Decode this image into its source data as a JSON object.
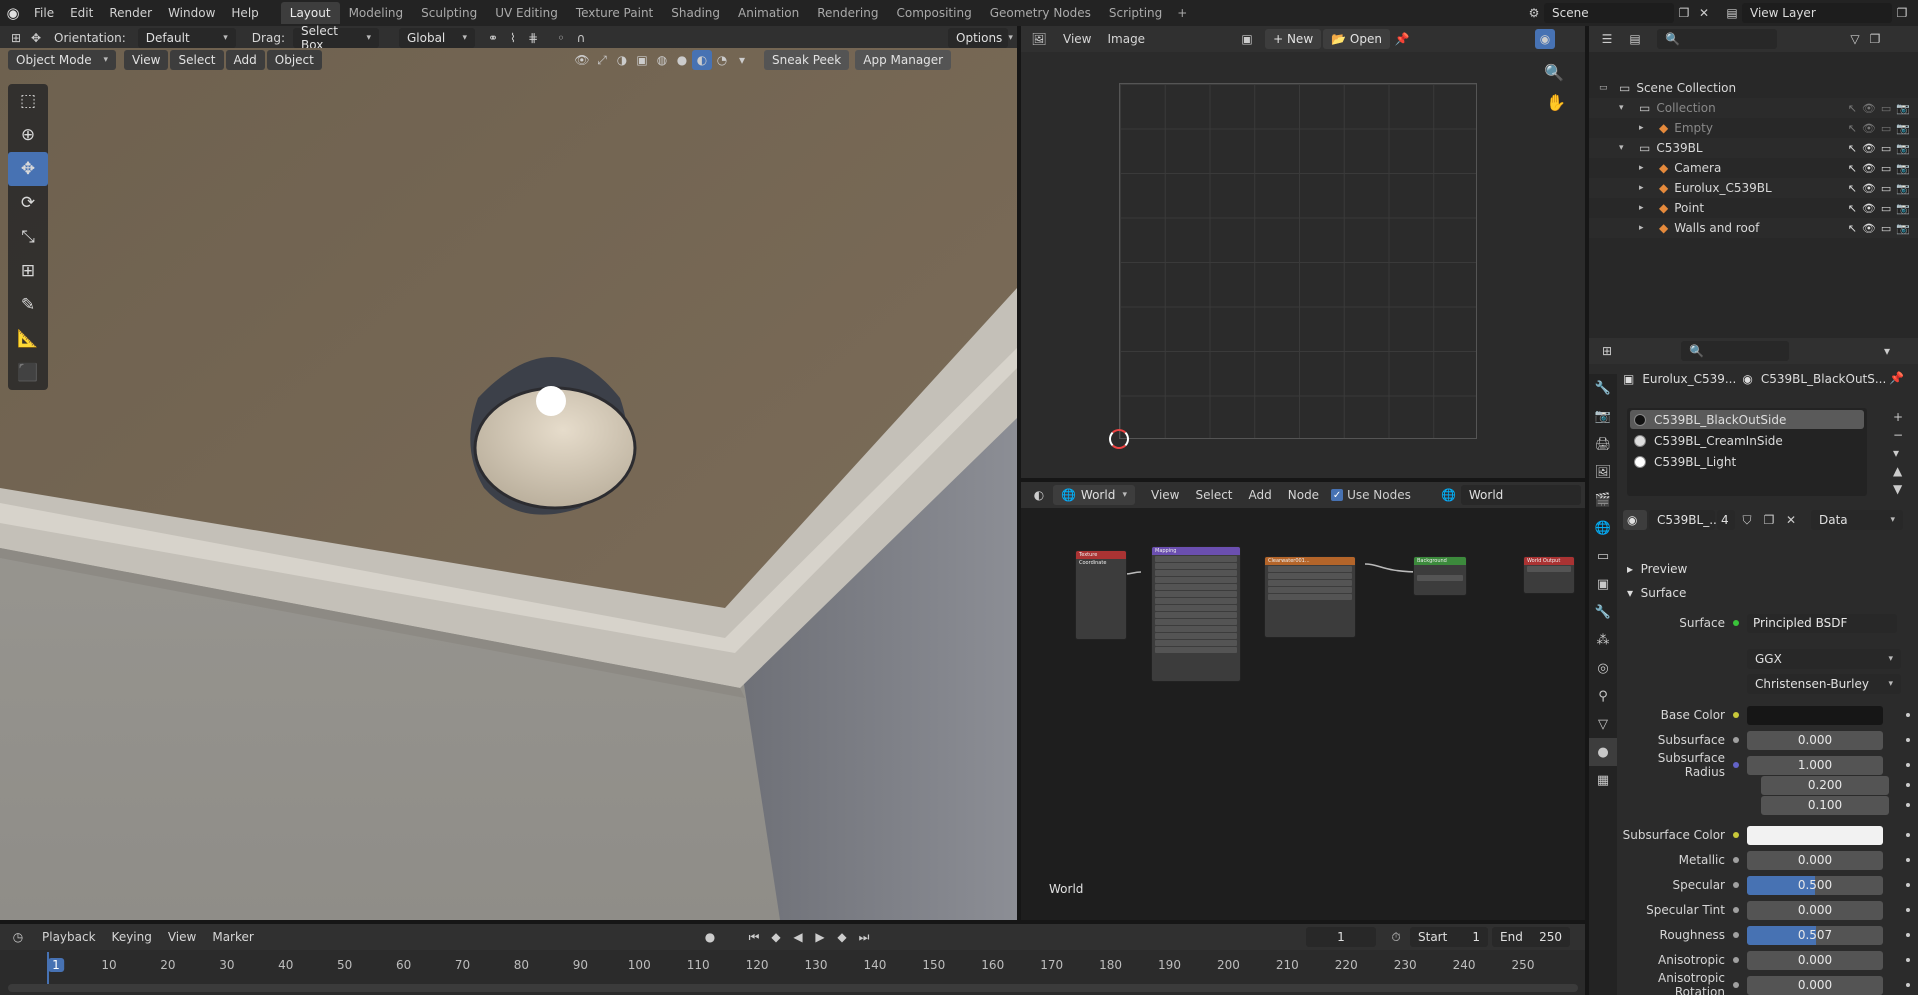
{
  "topbar": {
    "menus": [
      "File",
      "Edit",
      "Render",
      "Window",
      "Help"
    ],
    "workspaces": [
      "Layout",
      "Modeling",
      "Sculpting",
      "UV Editing",
      "Texture Paint",
      "Shading",
      "Animation",
      "Rendering",
      "Compositing",
      "Geometry Nodes",
      "Scripting"
    ],
    "active_workspace": "Layout",
    "scene": "Scene",
    "view_layer": "View Layer"
  },
  "viewport": {
    "orientation_label": "Orientation:",
    "orientation_value": "Default",
    "drag_label": "Drag:",
    "drag_value": "Select Box",
    "transform_space": "Global",
    "options": "Options",
    "mode": "Object Mode",
    "menus": [
      "View",
      "Select",
      "Add",
      "Object"
    ],
    "buttons": [
      "Sneak Peek",
      "App Manager"
    ]
  },
  "image_editor": {
    "menus": [
      "View",
      "Image"
    ],
    "new_label": "New",
    "open_label": "Open"
  },
  "node_editor": {
    "world_type": "World",
    "menus": [
      "View",
      "Select",
      "Add",
      "Node"
    ],
    "use_nodes_label": "Use Nodes",
    "use_nodes": true,
    "world_name": "World",
    "corner_label": "World",
    "nodes": [
      {
        "title": "Texture Coordinate",
        "color": "#a33"
      },
      {
        "title": "Mapping",
        "color": "#6b4fb0"
      },
      {
        "title": "Clearwater001...",
        "color": "#b4652a"
      },
      {
        "title": "Background",
        "color": "#3c8a3c"
      },
      {
        "title": "World Output",
        "color": "#a33"
      }
    ]
  },
  "outliner": {
    "items": [
      {
        "label": "Scene Collection",
        "level": 0
      },
      {
        "label": "Collection",
        "level": 1,
        "dim": true
      },
      {
        "label": "Empty",
        "level": 2,
        "dim": true
      },
      {
        "label": "C539BL",
        "level": 1
      },
      {
        "label": "Camera",
        "level": 2
      },
      {
        "label": "Eurolux_C539BL",
        "level": 2
      },
      {
        "label": "Point",
        "level": 2
      },
      {
        "label": "Walls and roof",
        "level": 2
      }
    ]
  },
  "properties": {
    "object_name": "Eurolux_C539...",
    "material_name": "C539BL_BlackOutS...",
    "material_slots": [
      "C539BL_BlackOutSide",
      "C539BL_CreamInSide",
      "C539BL_Light"
    ],
    "active_slot": 0,
    "material_field": "C539BL_...",
    "users": "4",
    "link": "Data",
    "panels": [
      "Preview",
      "Surface"
    ],
    "surface_label": "Surface",
    "surface_value": "Principled BSDF",
    "distribution": "GGX",
    "subsurface_method": "Christensen-Burley",
    "rows": [
      {
        "label": "Base Color",
        "type": "color",
        "color": "#161616",
        "socket": "#c8c83a"
      },
      {
        "label": "Subsurface",
        "value": "0.000",
        "fill": 0,
        "socket": "#a0a0a0"
      },
      {
        "label": "Subsurface Radius",
        "value": "1.000",
        "fill": 0,
        "socket": "#6363c7"
      },
      {
        "label": "",
        "value": "0.200",
        "fill": 0
      },
      {
        "label": "",
        "value": "0.100",
        "fill": 0
      },
      {
        "label": "Subsurface Color",
        "type": "color",
        "color": "#f2f2f2",
        "socket": "#c8c83a"
      },
      {
        "label": "Metallic",
        "value": "0.000",
        "fill": 0,
        "socket": "#a0a0a0"
      },
      {
        "label": "Specular",
        "value": "0.500",
        "fill": 0.5,
        "socket": "#a0a0a0"
      },
      {
        "label": "Specular Tint",
        "value": "0.000",
        "fill": 0,
        "socket": "#a0a0a0"
      },
      {
        "label": "Roughness",
        "value": "0.507",
        "fill": 0.507,
        "socket": "#a0a0a0"
      },
      {
        "label": "Anisotropic",
        "value": "0.000",
        "fill": 0,
        "socket": "#a0a0a0"
      },
      {
        "label": "Anisotropic Rotation",
        "value": "0.000",
        "fill": 0,
        "socket": "#a0a0a0"
      }
    ]
  },
  "timeline": {
    "menus": [
      "Playback",
      "Keying",
      "View",
      "Marker"
    ],
    "current_frame": "1",
    "start_label": "Start",
    "start": "1",
    "end_label": "End",
    "end": "250",
    "ticks": [
      "1",
      "10",
      "20",
      "30",
      "40",
      "50",
      "60",
      "70",
      "80",
      "90",
      "100",
      "110",
      "120",
      "130",
      "140",
      "150",
      "160",
      "170",
      "180",
      "190",
      "200",
      "210",
      "220",
      "230",
      "240",
      "250"
    ]
  },
  "colors": {
    "accent": "#4772b3",
    "header": "#303030",
    "panel": "#2b2b2b"
  }
}
